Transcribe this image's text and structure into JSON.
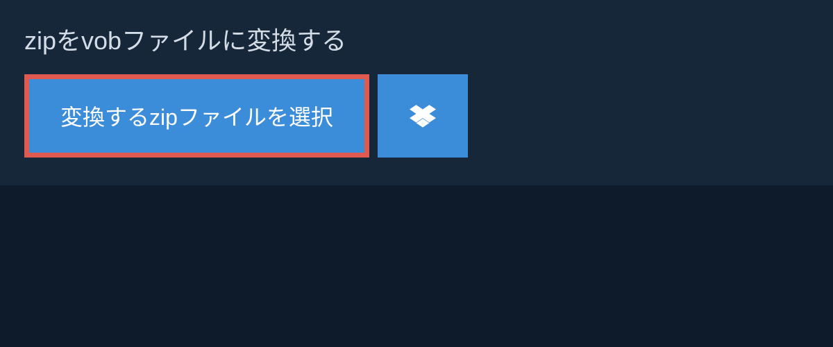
{
  "header": {
    "title": "zipをvobファイルに変換する"
  },
  "buttons": {
    "select_label": "変換するzipファイルを選択"
  },
  "colors": {
    "page_bg": "#0d1b2a",
    "panel_bg": "#16273a",
    "button_bg": "#3b8cd9",
    "button_border": "#e05a4f",
    "text_light": "#d4dce6",
    "text_white": "#ffffff"
  }
}
